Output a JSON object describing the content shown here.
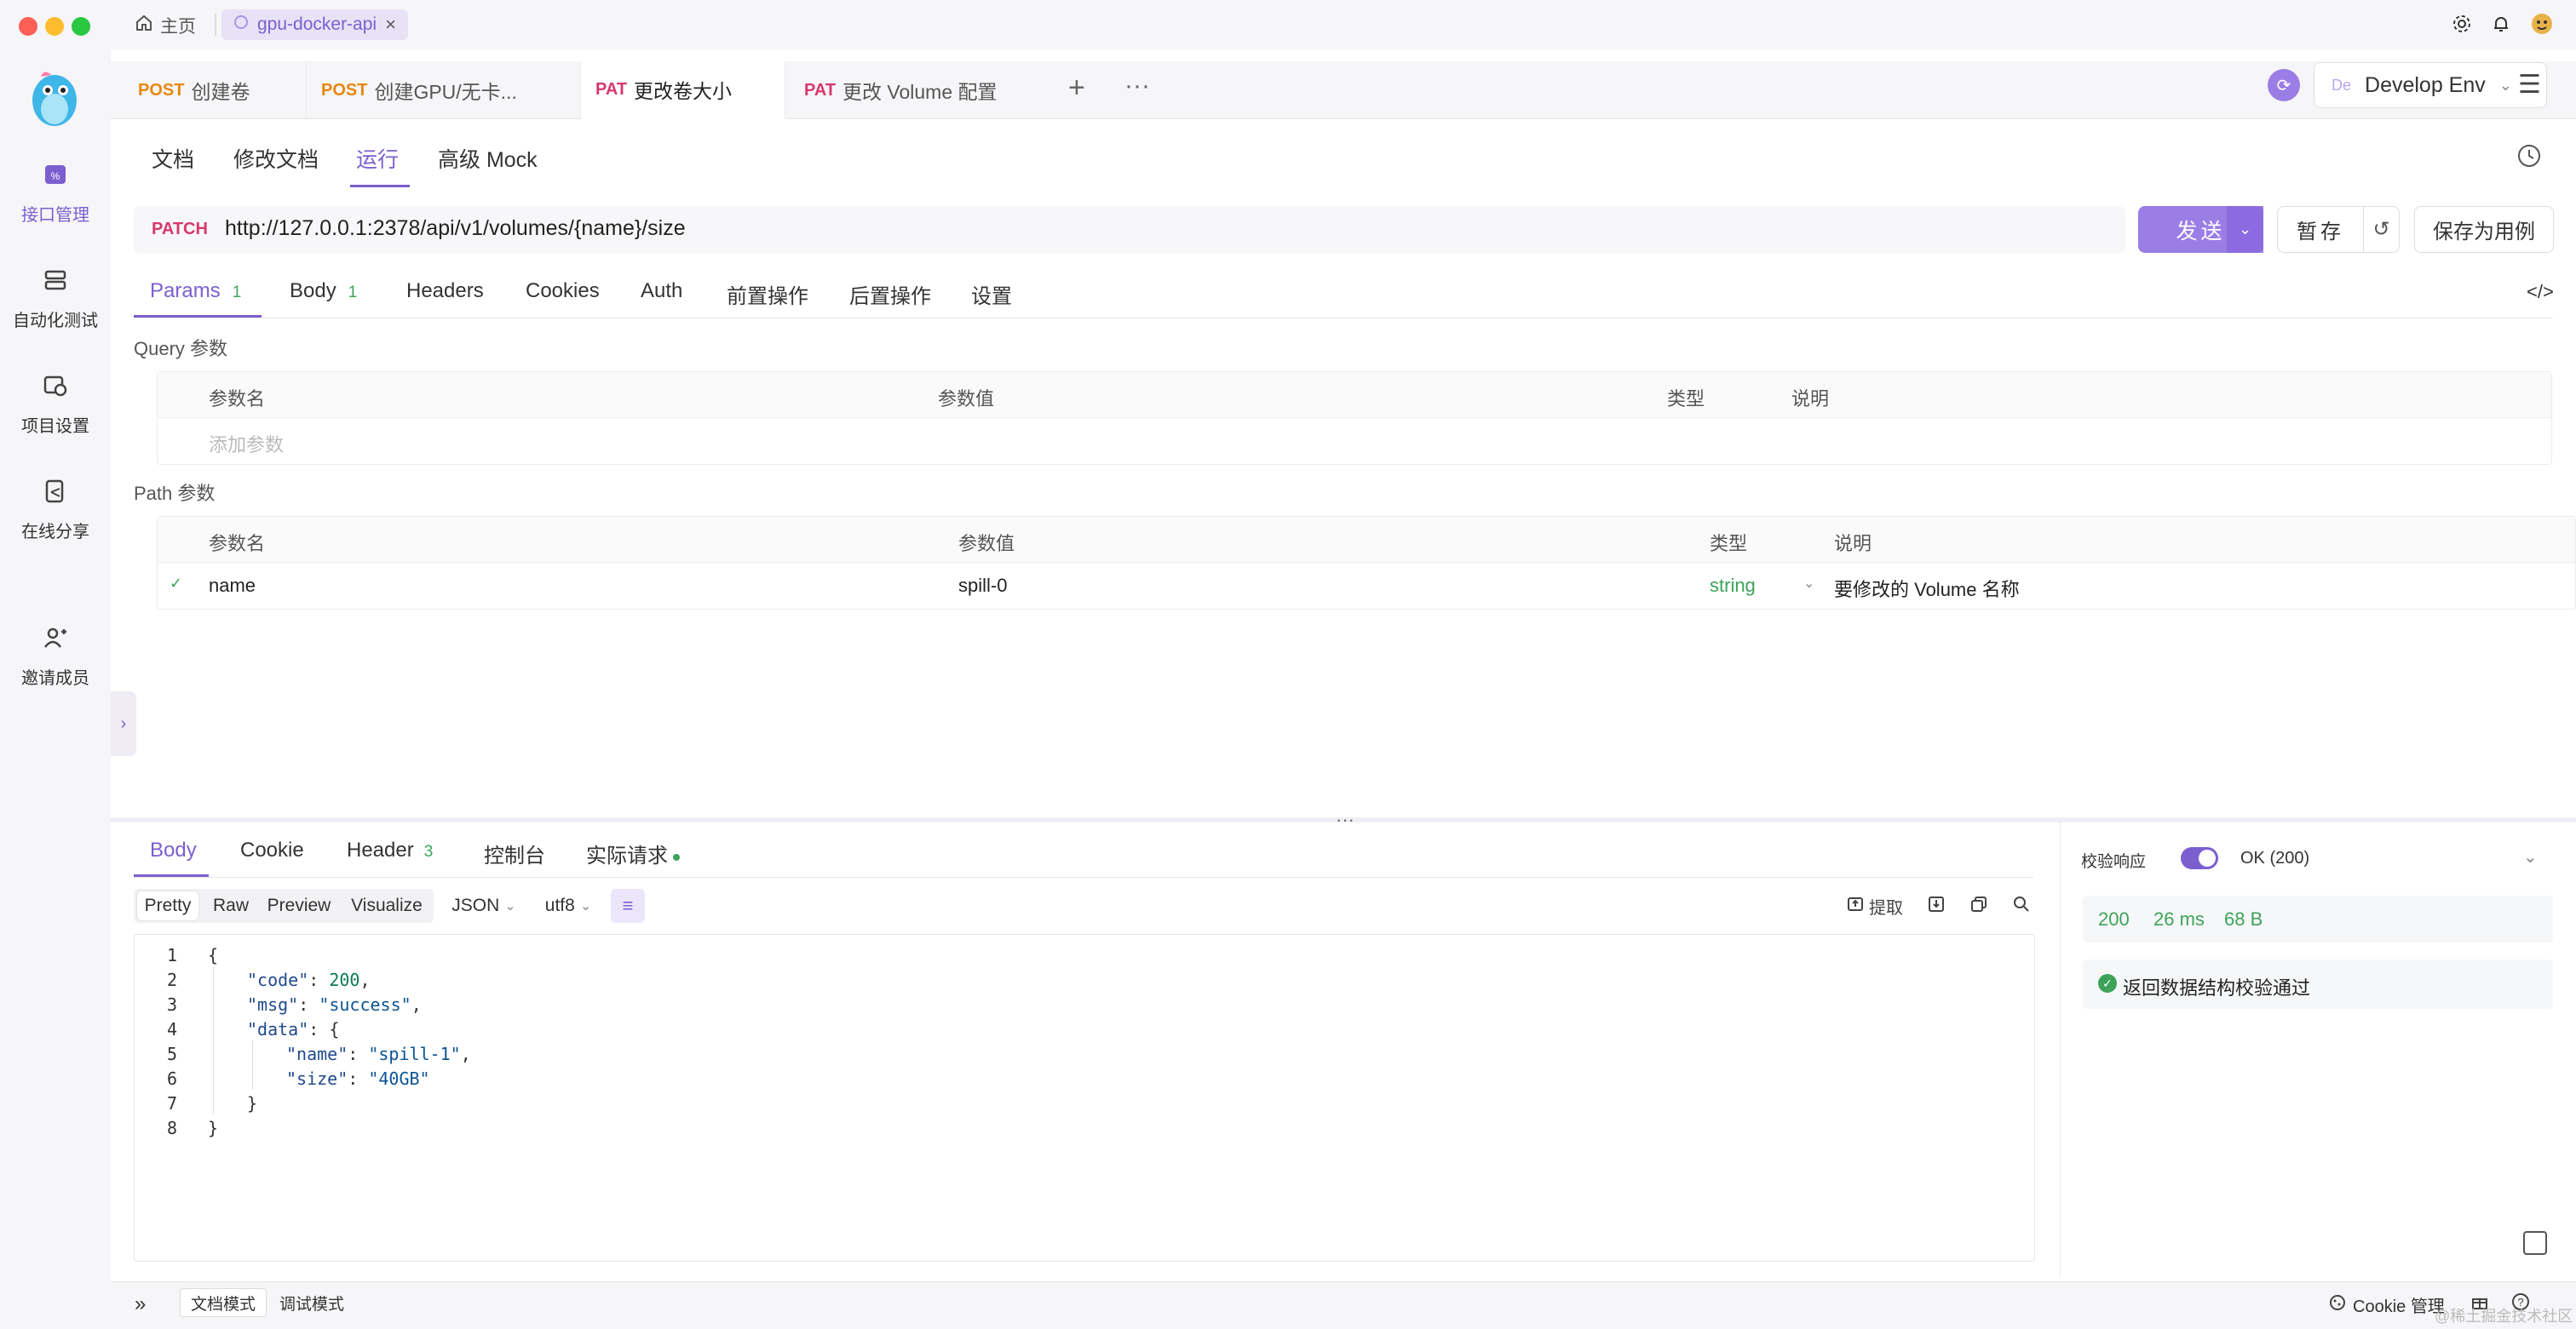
{
  "titlebar": {
    "home_label": "主页",
    "project_tab": "gpu-docker-api",
    "close_glyph": "×"
  },
  "sidebar": {
    "items": [
      {
        "label": "接口管理",
        "icon": "api-icon",
        "active": true
      },
      {
        "label": "自动化测试",
        "icon": "test-icon",
        "active": false
      },
      {
        "label": "项目设置",
        "icon": "settings-icon",
        "active": false
      },
      {
        "label": "在线分享",
        "icon": "share-icon",
        "active": false
      },
      {
        "label": "邀请成员",
        "icon": "add-user-icon",
        "active": false
      }
    ],
    "expand_glyph": "›"
  },
  "request_tabs": [
    {
      "method": "POST",
      "title": "创建卷",
      "method_color": "#e8870e"
    },
    {
      "method": "POST",
      "title": "创建GPU/无卡...",
      "method_color": "#e8870e"
    },
    {
      "method": "PAT",
      "title": "更改卷大小",
      "method_color": "#d8386e",
      "active": true
    },
    {
      "method": "PAT",
      "title": "更改 Volume 配置",
      "method_color": "#d8386e"
    }
  ],
  "env": {
    "prefix": "De",
    "name": "Develop Env"
  },
  "sub_tabs": [
    "文档",
    "修改文档",
    "运行",
    "高级 Mock"
  ],
  "request": {
    "method": "PATCH",
    "url": "http://127.0.0.1:2378/api/v1/volumes/{name}/size",
    "send_label": "发送",
    "save_label": "暂存",
    "save_case_label": "保存为用例"
  },
  "param_tabs": [
    {
      "label": "Params",
      "count": "1"
    },
    {
      "label": "Body",
      "count": "1"
    },
    {
      "label": "Headers",
      "count": ""
    },
    {
      "label": "Cookies",
      "count": ""
    },
    {
      "label": "Auth",
      "count": ""
    },
    {
      "label": "前置操作",
      "count": ""
    },
    {
      "label": "后置操作",
      "count": ""
    },
    {
      "label": "设置",
      "count": ""
    }
  ],
  "query": {
    "section_label": "Query 参数",
    "headers": [
      "参数名",
      "参数值",
      "类型",
      "说明"
    ],
    "add_placeholder": "添加参数"
  },
  "path": {
    "section_label": "Path 参数",
    "headers": [
      "参数名",
      "参数值",
      "类型",
      "说明"
    ],
    "rows": [
      {
        "name": "name",
        "value": "spill-0",
        "type": "string",
        "desc": "要修改的 Volume 名称"
      }
    ]
  },
  "response_tabs": [
    {
      "label": "Body",
      "count": ""
    },
    {
      "label": "Cookie",
      "count": ""
    },
    {
      "label": "Header",
      "count": "3"
    },
    {
      "label": "控制台",
      "count": ""
    },
    {
      "label": "实际请求",
      "count": ""
    }
  ],
  "view_modes": [
    "Pretty",
    "Raw",
    "Preview",
    "Visualize"
  ],
  "format": "JSON",
  "encoding": "utf8",
  "extract_label": "提取",
  "code_lines": [
    {
      "n": "1",
      "indent": 0,
      "parts": [
        [
          "p",
          "{"
        ]
      ]
    },
    {
      "n": "2",
      "indent": 1,
      "parts": [
        [
          "k",
          "\"code\""
        ],
        [
          "p",
          ": "
        ],
        [
          "n",
          "200"
        ],
        [
          "p",
          ","
        ]
      ]
    },
    {
      "n": "3",
      "indent": 1,
      "parts": [
        [
          "k",
          "\"msg\""
        ],
        [
          "p",
          ": "
        ],
        [
          "s",
          "\"success\""
        ],
        [
          "p",
          ","
        ]
      ]
    },
    {
      "n": "4",
      "indent": 1,
      "parts": [
        [
          "k",
          "\"data\""
        ],
        [
          "p",
          ": {"
        ]
      ]
    },
    {
      "n": "5",
      "indent": 2,
      "parts": [
        [
          "k",
          "\"name\""
        ],
        [
          "p",
          ": "
        ],
        [
          "s",
          "\"spill-1\""
        ],
        [
          "p",
          ","
        ]
      ]
    },
    {
      "n": "6",
      "indent": 2,
      "parts": [
        [
          "k",
          "\"size\""
        ],
        [
          "p",
          ": "
        ],
        [
          "s",
          "\"40GB\""
        ]
      ]
    },
    {
      "n": "7",
      "indent": 1,
      "parts": [
        [
          "p",
          "}"
        ]
      ]
    },
    {
      "n": "8",
      "indent": 0,
      "parts": [
        [
          "p",
          "}"
        ]
      ]
    }
  ],
  "validation": {
    "label": "校验响应",
    "status": "OK (200)",
    "code": "200",
    "time": "26 ms",
    "size": "68 B",
    "message": "返回数据结构校验通过"
  },
  "bottom": {
    "doc_mode": "文档模式",
    "debug_mode": "调试模式",
    "cookie_label": "Cookie 管理",
    "watermark": "@稀土掘金技术社区"
  },
  "colors": {
    "accent": "#7b5fcf",
    "post": "#e8870e",
    "patch": "#d8386e",
    "success": "#3da35a"
  }
}
